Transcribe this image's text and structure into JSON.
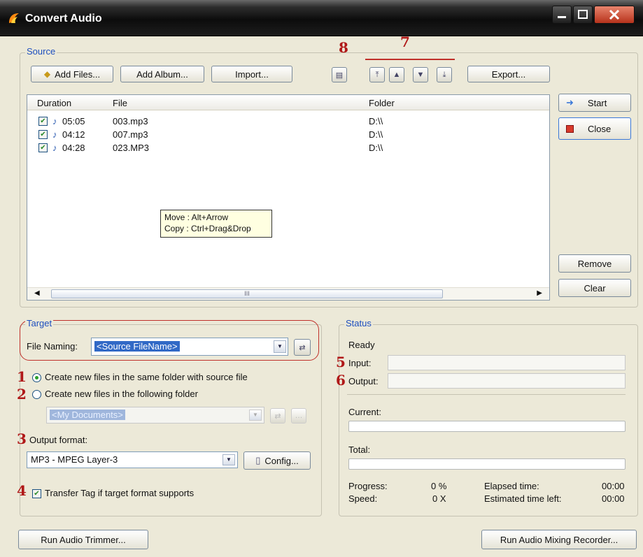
{
  "window": {
    "title": "Convert Audio"
  },
  "source": {
    "group_title": "Source",
    "toolbar": {
      "add_files": "Add Files...",
      "add_album": "Add Album...",
      "import": "Import...",
      "export": "Export..."
    },
    "columns": [
      "Duration",
      "File",
      "Folder"
    ],
    "rows": [
      {
        "checked": true,
        "duration": "05:05",
        "file": "003.mp3",
        "folder": "D:\\\\"
      },
      {
        "checked": true,
        "duration": "04:12",
        "file": "007.mp3",
        "folder": "D:\\\\"
      },
      {
        "checked": true,
        "duration": "04:28",
        "file": "023.MP3",
        "folder": "D:\\\\"
      }
    ],
    "tooltip": {
      "line1": "Move : Alt+Arrow",
      "line2": "Copy : Ctrl+Drag&Drop"
    },
    "scroll_grip": "III"
  },
  "side_buttons": {
    "start": "Start",
    "close": "Close",
    "remove": "Remove",
    "clear": "Clear"
  },
  "target": {
    "group_title": "Target",
    "file_naming_label": "File Naming:",
    "file_naming_value": "<Source FileName>",
    "radio_same_folder": "Create new files in the same folder with source file",
    "radio_following_folder": "Create new files in the following folder",
    "folder_value": "<My Documents>",
    "output_format_label": "Output format:",
    "output_format_value": "MP3 - MPEG Layer-3",
    "config_button": "Config...",
    "transfer_tag": "Transfer Tag if target format supports"
  },
  "status": {
    "group_title": "Status",
    "state": "Ready",
    "input_label": "Input:",
    "output_label": "Output:",
    "current_label": "Current:",
    "total_label": "Total:",
    "progress_label": "Progress:",
    "progress_value": "0 %",
    "speed_label": "Speed:",
    "speed_value": "0 X",
    "elapsed_label": "Elapsed time:",
    "elapsed_value": "00:00",
    "estimated_label": "Estimated time left:",
    "estimated_value": "00:00"
  },
  "annotations": {
    "n1": "1",
    "n2": "2",
    "n3": "3",
    "n4": "4",
    "n5": "5",
    "n6": "6",
    "n7": "7",
    "n8": "8"
  },
  "bottom": {
    "run_trimmer": "Run Audio Trimmer...",
    "run_recorder": "Run Audio Mixing Recorder..."
  },
  "colors": {
    "accent": "#1e4fbf",
    "annotation_red": "#b01818",
    "selection": "#3169c6"
  }
}
